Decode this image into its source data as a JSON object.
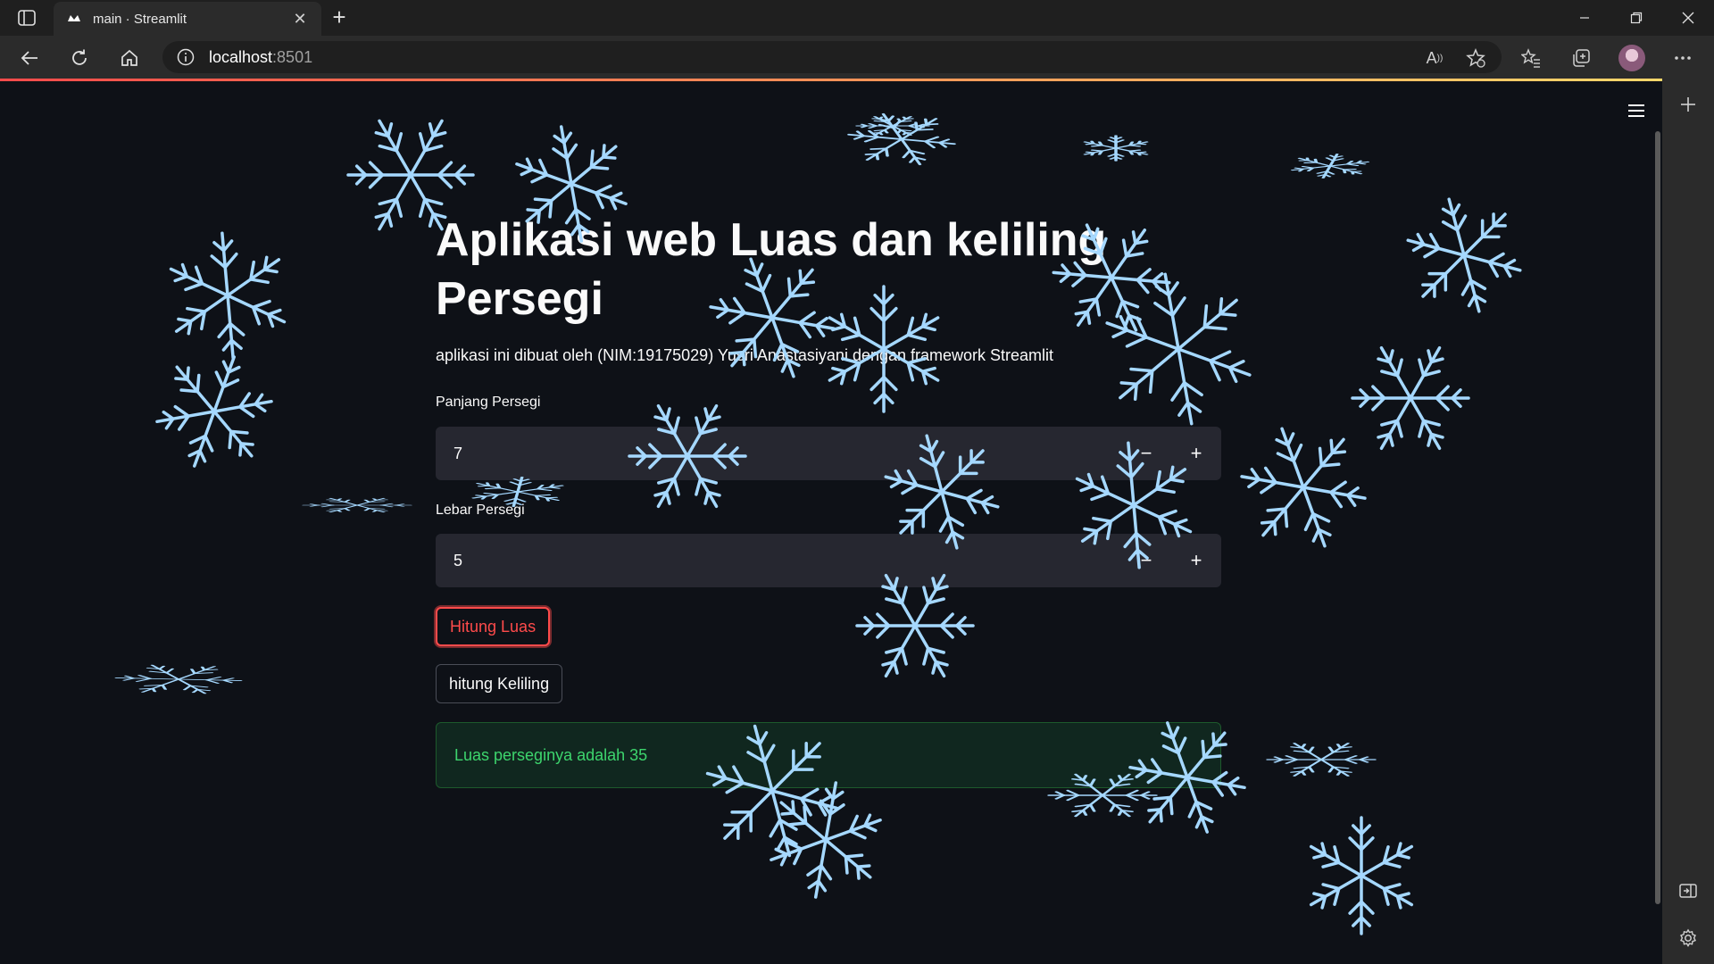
{
  "browser": {
    "tab_title": "main · Streamlit",
    "url_host": "localhost",
    "url_port": ":8501",
    "icons": [
      "sidebar-icon",
      "streamlit-favicon",
      "close-icon",
      "plus-icon",
      "minimize-icon",
      "restore-icon",
      "close-window-icon",
      "back-icon",
      "reload-icon",
      "home-icon",
      "info-icon",
      "read-aloud-icon",
      "favorite-add-icon",
      "favorites-icon",
      "collections-icon",
      "profile-avatar",
      "more-icon",
      "settings-icon"
    ]
  },
  "app": {
    "title": "Aplikasi web Luas dan keliling Persegi",
    "subtitle": "aplikasi ini dibuat oleh (NIM:19175029) Yusri Anastasiyani dengan framework Streamlit",
    "panjang": {
      "label": "Panjang Persegi",
      "value": "7",
      "minus": "−",
      "plus": "+"
    },
    "lebar": {
      "label": "Lebar Persegi",
      "value": "5",
      "minus": "−",
      "plus": "+"
    },
    "btn_luas": "Hitung Luas",
    "btn_keliling": "hitung Keliling",
    "result": "Luas perseginya adalah 35"
  },
  "colors": {
    "background": "#0e1117",
    "primary": "#ff4b4b",
    "success_text": "#3dd56d",
    "snowflake": "#a5d8ff"
  }
}
